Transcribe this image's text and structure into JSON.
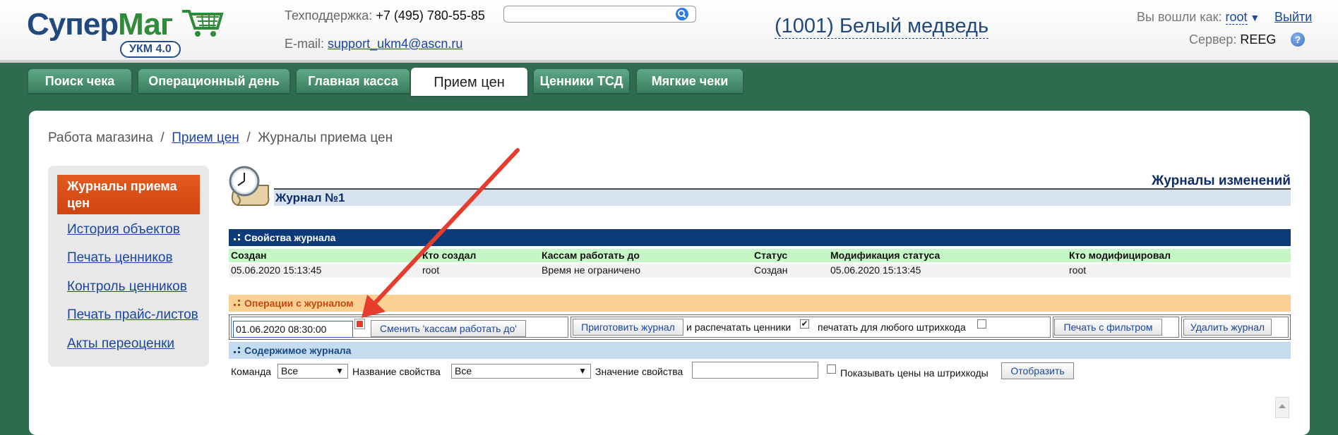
{
  "header": {
    "logo_text_a": "Супер",
    "logo_text_b": "Маг",
    "logo_badge": "УКМ 4.0",
    "support_label": "Техподдержка:",
    "support_phone": "+7 (495) 780-55-85",
    "email_label": "E-mail:",
    "email": "support_ukm4@ascn.ru",
    "search_placeholder": "",
    "store": "(1001) Белый медведь",
    "login_label": "Вы вошли как:",
    "user": "root",
    "logout": "Выйти",
    "server_label": "Сервер:",
    "server": "REEG"
  },
  "tabs": [
    {
      "label": "Поиск чека"
    },
    {
      "label": "Операционный день"
    },
    {
      "label": "Главная касса"
    },
    {
      "label": "Прием цен",
      "active": true
    },
    {
      "label": "Ценники ТСД"
    },
    {
      "label": "Мягкие чеки"
    }
  ],
  "breadcrumb": {
    "root": "Работа магазина",
    "sep": "/",
    "link": "Прием цен",
    "current": "Журналы приема цен"
  },
  "sidebar": {
    "active": "Журналы приема цен",
    "items": [
      "История объектов",
      "Печать ценников",
      "Контроль ценников",
      "Печать прайс-листов",
      "Акты переоценки"
    ]
  },
  "journal": {
    "section_title": "Журналы изменений",
    "title": "Журнал №1"
  },
  "properties": {
    "title": "Свойства журнала",
    "columns": [
      "Создан",
      "Кто создал",
      "Кассам работать до",
      "Статус",
      "Модификация статуса",
      "Кто модифицировал"
    ],
    "row": [
      "05.06.2020 15:13:45",
      "root",
      "Время не ограничено",
      "Создан",
      "05.06.2020 15:13:45",
      "root"
    ]
  },
  "operations": {
    "title": "Операции с журналом",
    "date_value": "01.06.2020 08:30:00",
    "change_button": "Сменить 'кассам работать до'",
    "prepare_button": "Приготовить журнал",
    "print_text": "и распечатать ценники",
    "print_checked": true,
    "any_barcode_text": "печатать для любого штрихкода",
    "any_barcode_checked": false,
    "filter_button": "Печать с фильтром",
    "delete_button": "Удалить журнал"
  },
  "contents": {
    "title": "Содержимое журнала",
    "command_label": "Команда",
    "command_value": "Все",
    "prop_name_label": "Название свойства",
    "prop_name_value": "Все",
    "prop_value_label": "Значение свойства",
    "show_prices_text": "Показывать цены на штрихкоды",
    "show_button": "Отобразить"
  },
  "colors": {
    "background": "#2f6b4f",
    "brand_blue": "#21497e",
    "tab_green": "#4a9070",
    "active_orange": "#e35a1d",
    "section_navy": "#0d3a78",
    "annotation_arrow": "#e43d30"
  }
}
